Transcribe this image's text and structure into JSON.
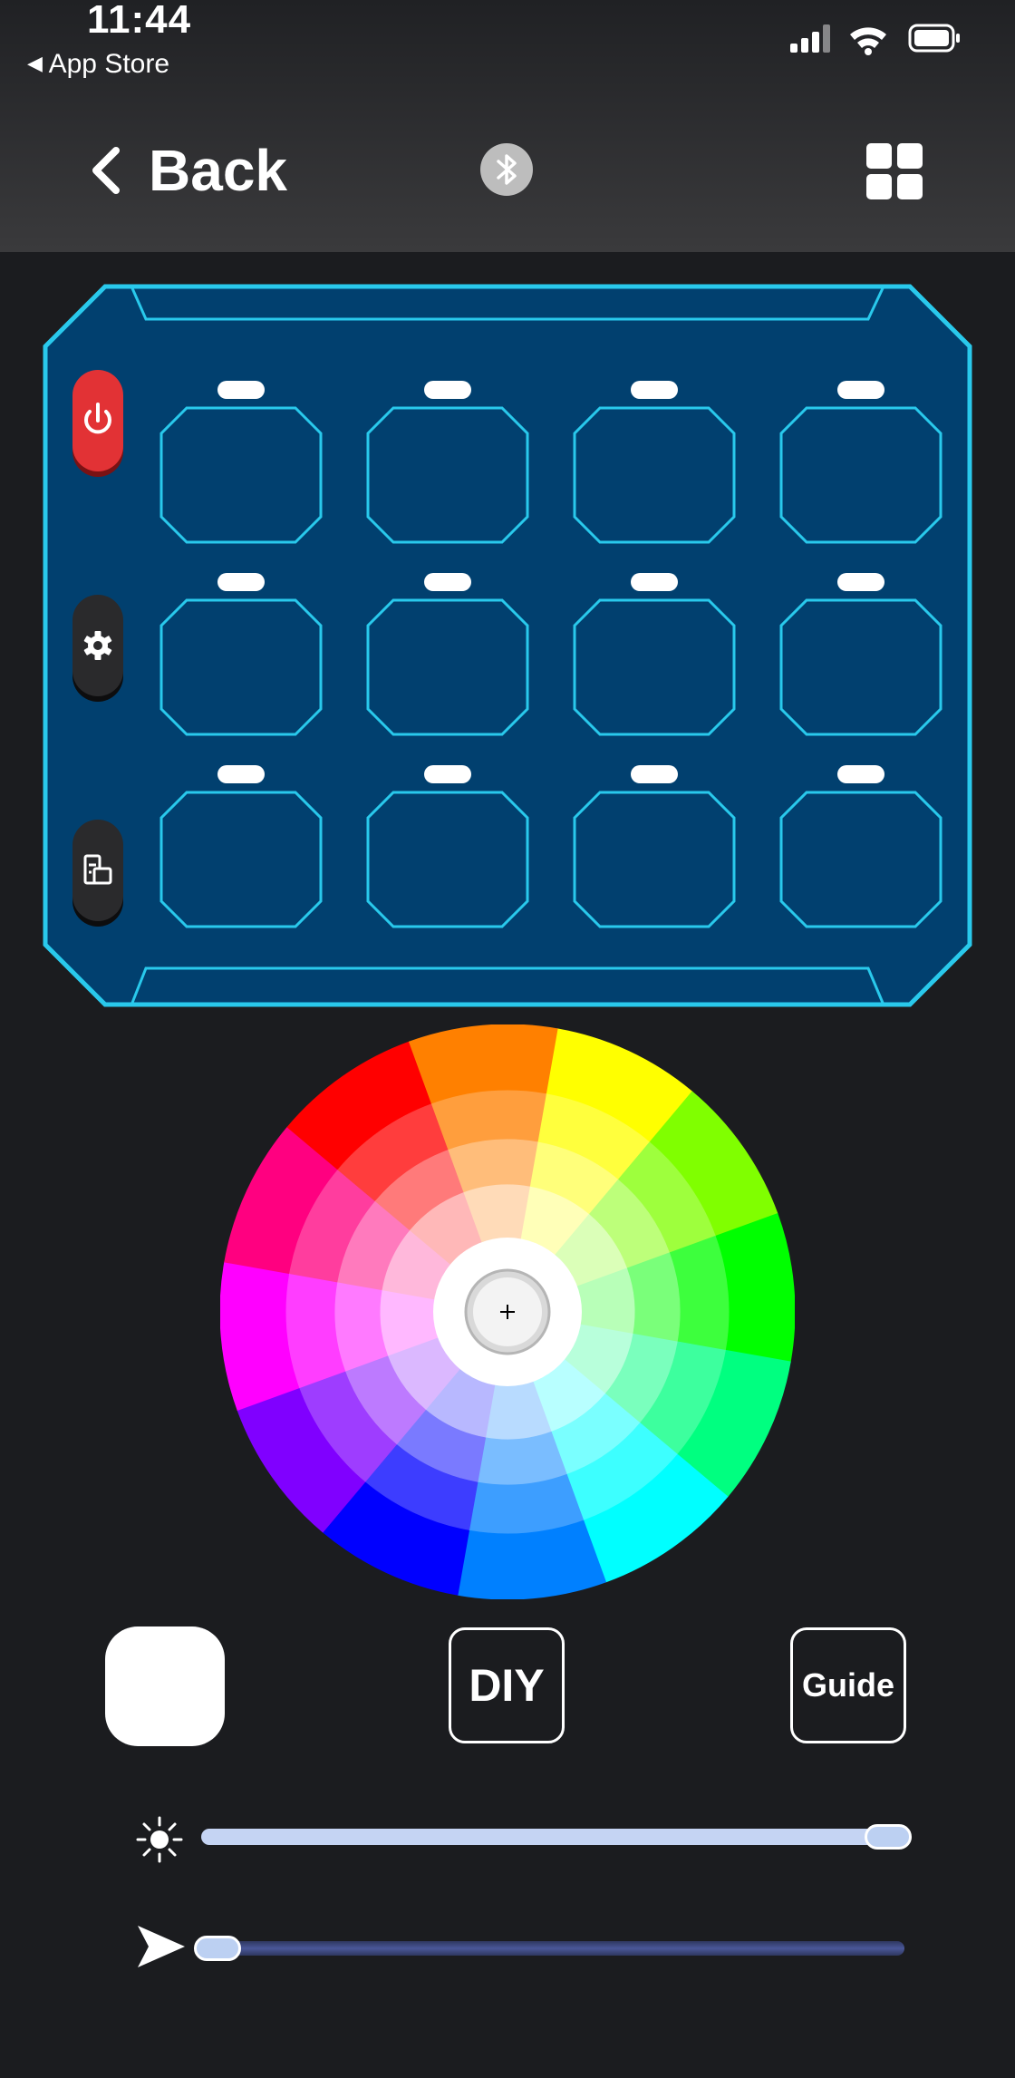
{
  "status_bar": {
    "time": "11:44",
    "back_app": "App Store"
  },
  "nav": {
    "back_label": "Back"
  },
  "icons": {
    "bluetooth": "bluetooth-icon",
    "grid": "grid-icon",
    "power": "power-icon",
    "settings": "gear-icon",
    "layout": "layout-icon",
    "brightness": "sun-icon",
    "speed": "arrow-icon"
  },
  "key_grid": {
    "rows": 3,
    "cols": 4
  },
  "buttons": {
    "diy": "DIY",
    "guide": "Guide"
  },
  "sliders": {
    "brightness_level": 1.0,
    "speed_level": 0.0
  },
  "colors": {
    "pad_fill": "#01406f",
    "pad_outline": "#29c9ec",
    "power_button": "#e23235",
    "selected_color": "#ffffff",
    "brightness_track": "#c5d4f3",
    "speed_track": "#3e4a84"
  }
}
